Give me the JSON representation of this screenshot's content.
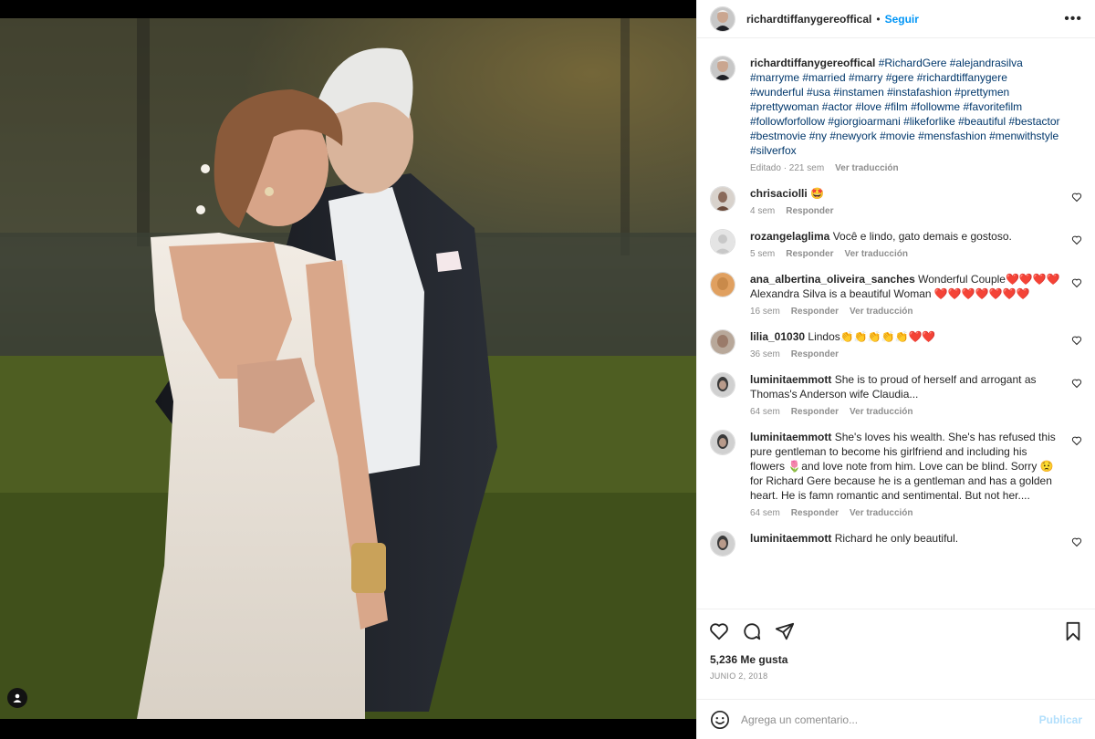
{
  "post": {
    "username": "richardtiffanygereoffical",
    "follow_label": "Seguir",
    "separator": "•",
    "more_label": "•••",
    "caption_hashtags": "#RichardGere #alejandrasilva #marryme #married #marry #gere #richardtiffanygere #wunderful #usa #instamen #instafashion #prettymen #prettywoman #actor #love #film #followme #favoritefilm #followforfollow #giorgioarmani #likeforlike #beautiful #bestactor #bestmovie #ny #newyork #movie #mensfashion #menwithstyle #silverfox",
    "caption_meta": "Editado · 221 sem",
    "caption_translate": "Ver traducción",
    "likes": "5,236 Me gusta",
    "date": "JUNIO 2, 2018"
  },
  "comments": [
    {
      "user": "chrisaciolli",
      "text": "🤩",
      "time": "4 sem",
      "reply": "Responder",
      "translate": "",
      "avatar_color": "#8a6a5a"
    },
    {
      "user": "rozangelaglima",
      "text": "Você e lindo, gato demais e gostoso.",
      "time": "5 sem",
      "reply": "Responder",
      "translate": "Ver traducción",
      "avatar_color": "#d4d4d4"
    },
    {
      "user": "ana_albertina_oliveira_sanches",
      "text": "Wonderful Couple❤️❤️❤️❤️ Alexandra Silva is a beautiful Woman ❤️❤️❤️❤️❤️❤️❤️",
      "time": "16 sem",
      "reply": "Responder",
      "translate": "Ver traducción",
      "avatar_color": "#c98a4a"
    },
    {
      "user": "lilia_01030",
      "text": "Lindos👏👏👏👏👏❤️❤️",
      "time": "36 sem",
      "reply": "Responder",
      "translate": "",
      "avatar_color": "#9a7b6a"
    },
    {
      "user": "luminitaemmott",
      "text": "She is to proud of herself and arrogant as Thomas's Anderson wife Claudia...",
      "time": "64 sem",
      "reply": "Responder",
      "translate": "Ver traducción",
      "avatar_color": "#3a3a3a"
    },
    {
      "user": "luminitaemmott",
      "text": "She's loves his wealth. She's has refused this pure gentleman to become his girlfriend and including his flowers 🌷and love note from him. Love can be blind. Sorry 😟 for Richard Gere because he is a gentleman and has a golden heart. He is famn romantic and sentimental. But not her....",
      "time": "64 sem",
      "reply": "Responder",
      "translate": "Ver traducción",
      "avatar_color": "#3a3a3a"
    },
    {
      "user": "luminitaemmott",
      "text": "Richard he only beautiful.",
      "time": "",
      "reply": "",
      "translate": "",
      "avatar_color": "#3a3a3a"
    }
  ],
  "add_comment": {
    "placeholder": "Agrega un comentario...",
    "publish_label": "Publicar"
  },
  "colors": {
    "link": "#0095f6",
    "hashtag": "#00376b",
    "muted": "#8e8e8e",
    "publish_disabled": "#b2dffc"
  },
  "icons": [
    "heart-icon",
    "comment-icon",
    "share-icon",
    "bookmark-icon",
    "emoji-icon",
    "tag-user-icon",
    "more-icon"
  ]
}
